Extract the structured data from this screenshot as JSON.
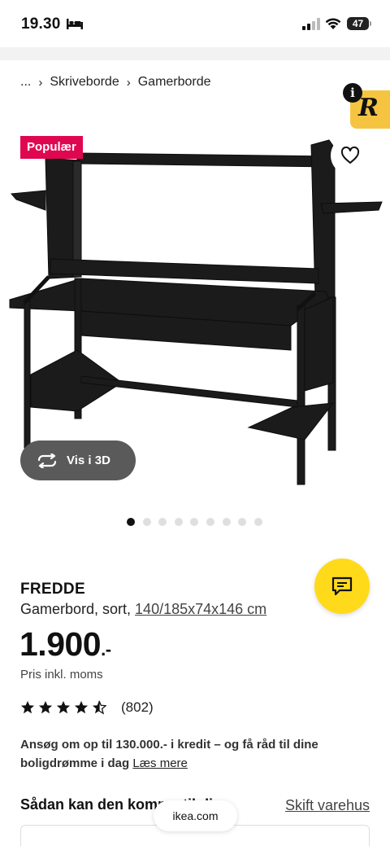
{
  "status_bar": {
    "time": "19.30",
    "battery": "47"
  },
  "breadcrumb": {
    "ellipsis": "...",
    "sep": "›",
    "items": [
      "Skriveborde",
      "Gamerborde"
    ]
  },
  "badge": {
    "popular": "Populær"
  },
  "view_3d": {
    "label": "Vis i 3D"
  },
  "carousel": {
    "count": 9,
    "active_index": 0
  },
  "product": {
    "name": "FREDDE",
    "desc_prefix": "Gamerbord, sort, ",
    "dimensions": "140/185x74x146 cm",
    "price_main": "1.900",
    "price_suffix": ".-",
    "price_note": "Pris inkl. moms",
    "rating_value": 4.5,
    "rating_count": "(802)"
  },
  "credit": {
    "text": "Ansøg om op til 130.000.- i kredit – og få råd til dine boligdrømme i dag",
    "link": "Læs mere"
  },
  "section": {
    "title": "Sådan kan den komme til dig",
    "change_store": "Skift varehus"
  },
  "browser": {
    "url": "ikea.com"
  },
  "icons": {
    "favorite": "heart-icon",
    "chat": "chat-icon",
    "rotate": "rotate-3d-icon",
    "extension": "reader-extension-icon"
  },
  "colors": {
    "popular_badge": "#e00751",
    "chat_button": "#ffda1a",
    "view3d_button": "#5a5a5a",
    "extension_badge": "#f5c542"
  }
}
